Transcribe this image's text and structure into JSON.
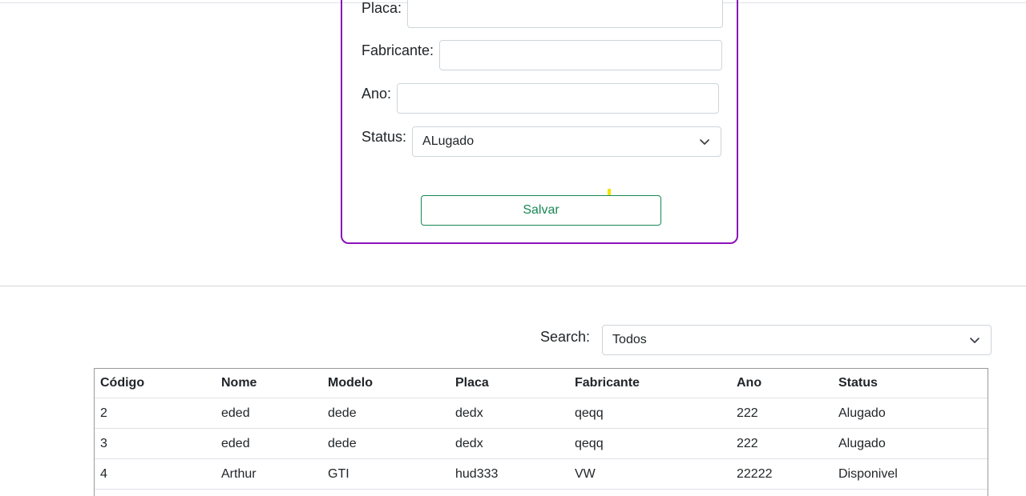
{
  "form": {
    "fields": [
      {
        "label": "Placa:",
        "value": ""
      },
      {
        "label": "Fabricante:",
        "value": ""
      },
      {
        "label": "Ano:",
        "value": ""
      }
    ],
    "status": {
      "label": "Status:",
      "selected": "ALugado"
    },
    "save_label": "Salvar"
  },
  "search": {
    "label": "Search:",
    "selected": "Todos"
  },
  "table": {
    "headers": [
      "Código",
      "Nome",
      "Modelo",
      "Placa",
      "Fabricante",
      "Ano",
      "Status"
    ],
    "rows": [
      [
        "2",
        "eded",
        "dede",
        "dedx",
        "qeqq",
        "222",
        "Alugado"
      ],
      [
        "3",
        "eded",
        "dede",
        "dedx",
        "qeqq",
        "222",
        "Alugado"
      ],
      [
        "4",
        "Arthur",
        "GTI",
        "hud333",
        "VW",
        "22222",
        "Disponivel"
      ]
    ]
  },
  "colors": {
    "card_border": "#8a11b8",
    "save_accent": "#198754"
  },
  "icons": {
    "dropdown": "chevron-down-icon"
  }
}
